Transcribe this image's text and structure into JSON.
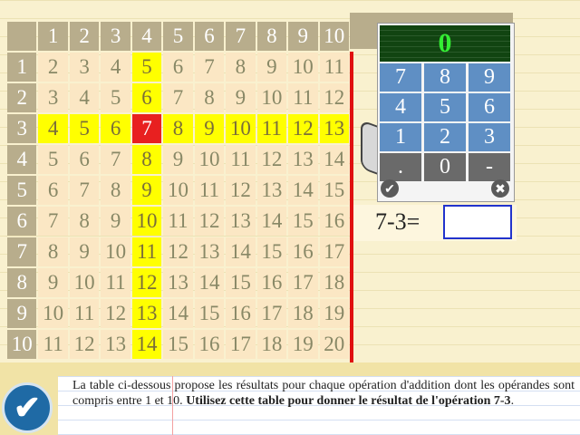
{
  "table": {
    "header": [
      "1",
      "2",
      "3",
      "4",
      "5",
      "6",
      "7",
      "8",
      "9",
      "10"
    ],
    "rows": [
      [
        "2",
        "3",
        "4",
        "5",
        "6",
        "7",
        "8",
        "9",
        "10",
        "11"
      ],
      [
        "3",
        "4",
        "5",
        "6",
        "7",
        "8",
        "9",
        "10",
        "11",
        "12"
      ],
      [
        "4",
        "5",
        "6",
        "7",
        "8",
        "9",
        "10",
        "11",
        "12",
        "13"
      ],
      [
        "5",
        "6",
        "7",
        "8",
        "9",
        "10",
        "11",
        "12",
        "13",
        "14"
      ],
      [
        "6",
        "7",
        "8",
        "9",
        "10",
        "11",
        "12",
        "13",
        "14",
        "15"
      ],
      [
        "7",
        "8",
        "9",
        "10",
        "11",
        "12",
        "13",
        "14",
        "15",
        "16"
      ],
      [
        "8",
        "9",
        "10",
        "11",
        "12",
        "13",
        "14",
        "15",
        "16",
        "17"
      ],
      [
        "9",
        "10",
        "11",
        "12",
        "13",
        "14",
        "15",
        "16",
        "17",
        "18"
      ],
      [
        "10",
        "11",
        "12",
        "13",
        "14",
        "15",
        "16",
        "17",
        "18",
        "19"
      ],
      [
        "11",
        "12",
        "13",
        "14",
        "15",
        "16",
        "17",
        "18",
        "19",
        "20"
      ]
    ],
    "highlight_row": 3,
    "highlight_col": 4
  },
  "keypad": {
    "display": "0",
    "keys": [
      "7",
      "8",
      "9",
      "4",
      "5",
      "6",
      "1",
      "2",
      "3",
      ".",
      "0",
      "-"
    ],
    "ok_icon": "check-icon",
    "cancel_icon": "close-icon"
  },
  "question": {
    "label": "7-3=",
    "answer": ""
  },
  "instruction": {
    "normal": "La table ci-dessous propose les résultats pour chaque opération d'addition dont les opérandes sont compris entre 1 et 10. ",
    "bold": "Utilisez cette table pour donner le résultat de l'opération 7-3",
    "end": "."
  },
  "validate_icon": "check-icon"
}
